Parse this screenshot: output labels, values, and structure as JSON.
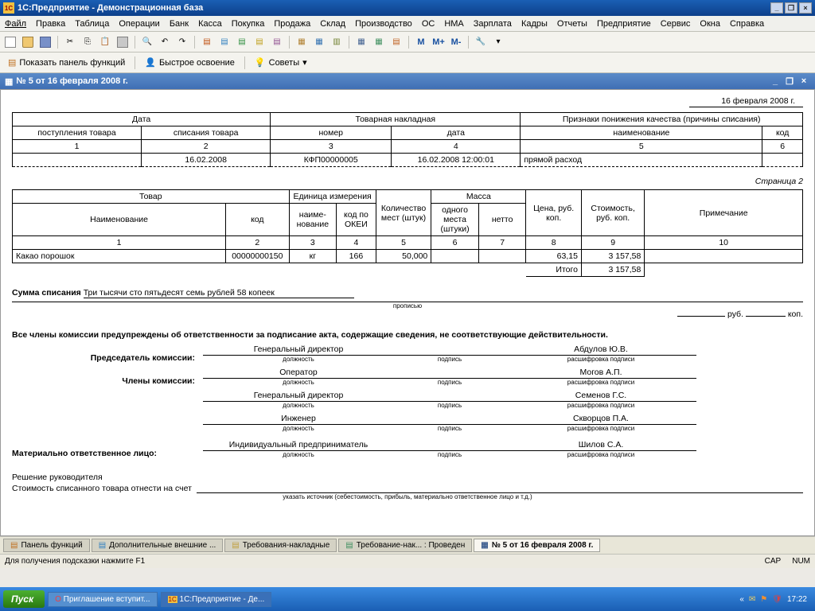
{
  "title": "1С:Предприятие - Демонстрационная база",
  "menu": [
    "Файл",
    "Правка",
    "Таблица",
    "Операции",
    "Банк",
    "Касса",
    "Покупка",
    "Продажа",
    "Склад",
    "Производство",
    "ОС",
    "НМА",
    "Зарплата",
    "Кадры",
    "Отчеты",
    "Предприятие",
    "Сервис",
    "Окна",
    "Справка"
  ],
  "toolbar2": {
    "panel": "Показать панель функций",
    "fast": "Быстрое освоение",
    "tips": "Советы"
  },
  "doc_title": "№ 5 от 16 февраля 2008 г.",
  "date_header": "16 февраля 2008 г.",
  "headers1": {
    "date": "Дата",
    "invoice": "Товарная накладная",
    "quality": "Признаки понижения качества (причины списания)",
    "receipt": "поступления товара",
    "writeoff": "списания товара",
    "number": "номер",
    "subdate": "дата",
    "name": "наименование",
    "code": "код"
  },
  "row1": {
    "c1": "1",
    "c2": "2",
    "c3": "3",
    "c4": "4",
    "c5": "5",
    "c6": "6"
  },
  "row2": {
    "c1": "",
    "c2": "16.02.2008",
    "c3": "КФП00000005",
    "c4": "16.02.2008 12:00:01",
    "c5": "прямой расход",
    "c6": ""
  },
  "page": "Страница 2",
  "headers2": {
    "product": "Товар",
    "uom": "Единица измерения",
    "qty": "Количество мест (штук)",
    "mass": "Масса",
    "price": "Цена, руб. коп.",
    "cost": "Стоимость, руб. коп.",
    "note": "Примечание",
    "name": "Наименование",
    "pcode": "код",
    "uom_name": "наиме-\nнование",
    "okei": "код по ОКЕИ",
    "mass_one": "одного места (штуки)",
    "netto": "нетто"
  },
  "num2": {
    "c1": "1",
    "c2": "2",
    "c3": "3",
    "c4": "4",
    "c5": "5",
    "c6": "6",
    "c7": "7",
    "c8": "8",
    "c9": "9",
    "c10": "10"
  },
  "prod": {
    "name": "Какао порошок",
    "code": "00000000150",
    "uom": "кг",
    "okei": "166",
    "qty": "50,000",
    "m1": "",
    "m2": "",
    "price": "63,15",
    "cost": "3 157,58",
    "note": ""
  },
  "total_label": "Итого",
  "total": "3 157,58",
  "sum_label": "Сумма списания",
  "sum_text": "Три тысячи сто пятьдесят семь рублей 58 копеек",
  "sub_words": "прописью",
  "rub": "руб.",
  "kop": "коп.",
  "warning": "Все члены комиссии предупреждены об ответственности за подписание акта, содержащие сведения, не соответствующие действительности.",
  "sig": {
    "chair_label": "Председатель комиссии:",
    "members_label": "Члены комиссии:",
    "resp_label": "Материально ответственное лицо:",
    "position": "должность",
    "signature": "подпись",
    "decode": "расшифровка подписи",
    "chair_pos": "Генеральный директор",
    "chair_name": "Абдулов Ю.В.",
    "m1_pos": "Оператор",
    "m1_name": "Могов А.П.",
    "m2_pos": "Генеральный директор",
    "m2_name": "Семенов Г.С.",
    "m3_pos": "Инженер",
    "m3_name": "Скворцов П.А.",
    "resp_pos": "Индивидуальный предприниматель",
    "resp_name": "Шилов С.А."
  },
  "decision": "Решение руководителя",
  "writeoff_line": "Стоимость списанного товара отнести на счет",
  "writeoff_sub": "указать источник (себестоимость, прибыль, материально ответственное лицо и т.д.)",
  "tabs": [
    "Панель функций",
    "Дополнительные внешние ...",
    "Требования-накладные",
    "Требование-нак... : Проведен",
    "№ 5 от 16 февраля 2008 г."
  ],
  "hint": "Для получения подсказки нажмите F1",
  "status": {
    "cap": "CAP",
    "num": "NUM"
  },
  "taskbar": {
    "start": "Пуск",
    "b1": "Приглашение вступит...",
    "b2": "1С:Предприятие - Де...",
    "time": "17:22"
  },
  "M": {
    "m": "M",
    "mp": "M+",
    "mm": "M-"
  }
}
